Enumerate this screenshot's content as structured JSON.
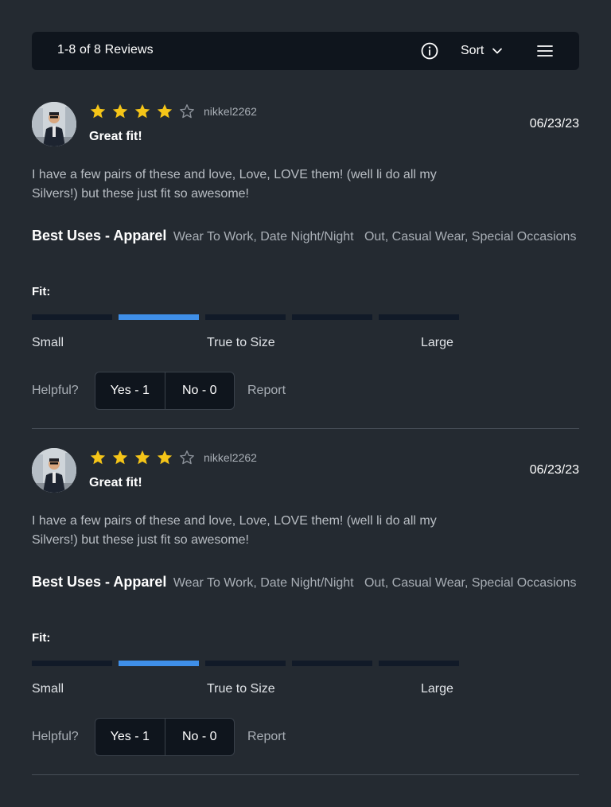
{
  "header": {
    "count_label": "1-8 of 8 Reviews",
    "info_icon": "info-circle-icon",
    "sort_label": "Sort",
    "sort_icon": "chevron-down-icon",
    "menu_icon": "hamburger-menu-icon"
  },
  "colors": {
    "background": "#242a31",
    "bar": "#0f151d",
    "star_filled": "#f5c518",
    "star_empty": "#8b9199",
    "fit_active": "#3f8fe8",
    "fit_inactive": "#111a28"
  },
  "reviews": [
    {
      "rating": 4,
      "max_rating": 5,
      "username": "nikkel2262",
      "title": "Great fit!",
      "date": "06/23/23",
      "body": "I have a few pairs of these and love, Love, LOVE them! (well li do all my Silvers!) but these just fit so awesome!",
      "best_uses_label": "Best Uses - Apparel",
      "best_uses_values": "Wear To Work, Date Night/Night   Out, Casual Wear, Special Occasions",
      "fit_label": "Fit:",
      "fit_segments": 5,
      "fit_selected_index": 1,
      "fit_small": "Small",
      "fit_true": "True to Size",
      "fit_large": "Large",
      "helpful_label": "Helpful?",
      "yes_label": "Yes - 1",
      "no_label": "No - 0",
      "report_label": "Report"
    },
    {
      "rating": 4,
      "max_rating": 5,
      "username": "nikkel2262",
      "title": "Great fit!",
      "date": "06/23/23",
      "body": "I have a few pairs of these and love, Love, LOVE them! (well li do all my Silvers!) but these just fit so awesome!",
      "best_uses_label": "Best Uses - Apparel",
      "best_uses_values": "Wear To Work, Date Night/Night   Out, Casual Wear, Special Occasions",
      "fit_label": "Fit:",
      "fit_segments": 5,
      "fit_selected_index": 1,
      "fit_small": "Small",
      "fit_true": "True to Size",
      "fit_large": "Large",
      "helpful_label": "Helpful?",
      "yes_label": "Yes - 1",
      "no_label": "No - 0",
      "report_label": "Report"
    }
  ]
}
